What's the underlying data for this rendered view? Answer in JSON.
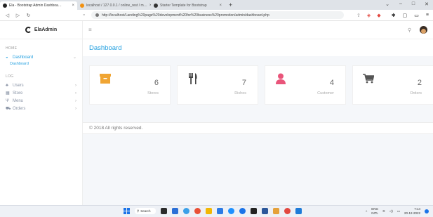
{
  "browser": {
    "tabs": [
      {
        "label": "Ela - Bootstrap Admin Dashboa…",
        "active": true
      },
      {
        "label": "localhost / 127.0.0.1 / online_rest / m…",
        "active": false
      },
      {
        "label": "Starter Template for Bootstrap",
        "active": false
      }
    ],
    "new_tab": "+",
    "url": "http://localhost/Landing%20page%20development%20for%20business%20promotion/admin/dashboard.php"
  },
  "sidebar": {
    "brand": "ElaAdmin",
    "sections": {
      "home": "HOME",
      "log": "LOG"
    },
    "dashboard": {
      "label": "Dashboard",
      "sub": "Dashboard"
    },
    "items": [
      {
        "label": "Users",
        "icon": "users-icon"
      },
      {
        "label": "Store",
        "icon": "store-icon"
      },
      {
        "label": "Menu",
        "icon": "menu-icon"
      },
      {
        "label": "Orders",
        "icon": "orders-icon"
      }
    ]
  },
  "header": {
    "page_title": "Dashboard"
  },
  "cards": [
    {
      "value": "6",
      "label": "Stores",
      "icon": "archive-icon",
      "color": "#f0a533"
    },
    {
      "value": "7",
      "label": "Dishes",
      "icon": "cutlery-icon",
      "color": "#444444"
    },
    {
      "value": "4",
      "label": "Customer",
      "icon": "user-icon",
      "color": "#e9557a"
    },
    {
      "value": "2",
      "label": "Orders",
      "icon": "cart-icon",
      "color": "#555555"
    }
  ],
  "footer": {
    "text": "© 2018 All rights reserved."
  },
  "taskbar": {
    "search": "Search",
    "lang_line1": "ENG",
    "lang_line2": "INTL",
    "time": "7:14",
    "date": "20-12-2022"
  },
  "colors": {
    "accent": "#26a1e0",
    "background": "#f5f7fa"
  }
}
